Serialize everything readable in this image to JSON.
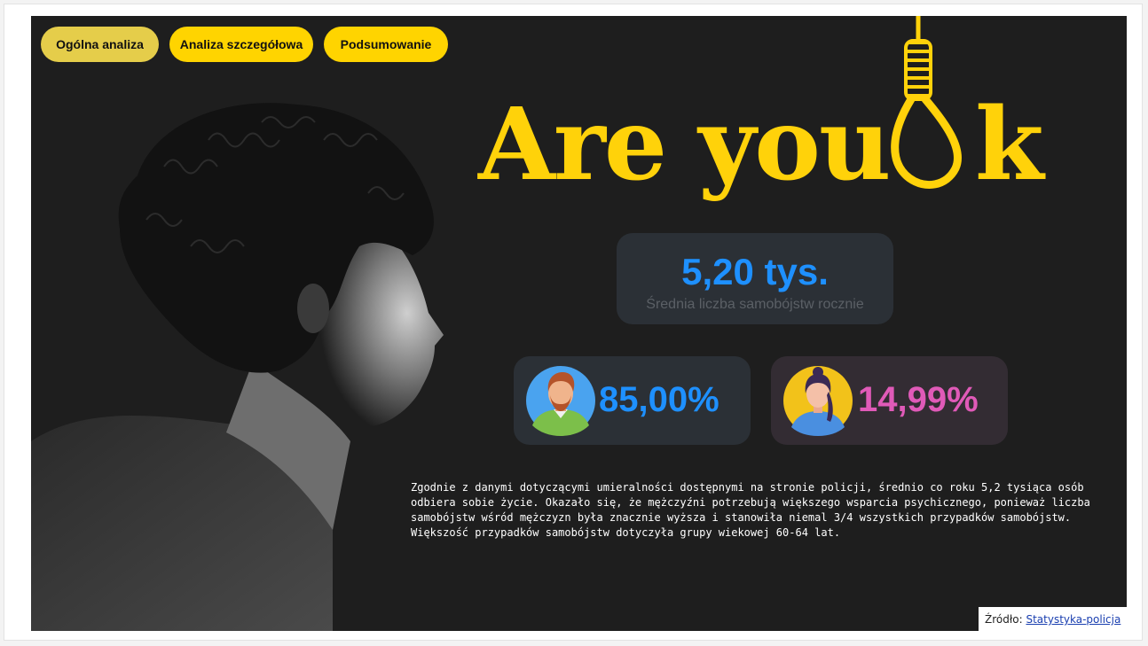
{
  "nav": {
    "items": [
      {
        "label": "Ogólna analiza"
      },
      {
        "label": "Analiza szczegółowa"
      },
      {
        "label": "Podsumowanie"
      }
    ]
  },
  "title": {
    "part1": "Are you ",
    "part2": "k"
  },
  "stats": {
    "total": {
      "value": "5,20 tys.",
      "label": "Średnia liczba samobójstw rocznie"
    },
    "men": {
      "value": "85,00%",
      "icon": "male-avatar-icon",
      "color": "#1e90ff"
    },
    "women": {
      "value": "14,99%",
      "icon": "female-avatar-icon",
      "color": "#e05ab8"
    }
  },
  "description": "Zgodnie z danymi dotyczącymi umieralności dostępnymi na stronie policji, średnio co roku 5,2 tysiąca osób odbiera sobie życie. Okazało się, że mężczyźni potrzebują większego wsparcia psychicznego, ponieważ liczba samobójstw wśród mężczyzn była znacznie wyższa i stanowiła niemal 3/4 wszystkich przypadków samobójstw. Większość przypadków samobójstw dotyczyła grupy wiekowej 60-64 lat.",
  "source": {
    "label": "Źródło: ",
    "link_text": "Statystyka-policja"
  },
  "colors": {
    "accent_yellow": "#ffd400",
    "background": "#1e1e1e"
  }
}
